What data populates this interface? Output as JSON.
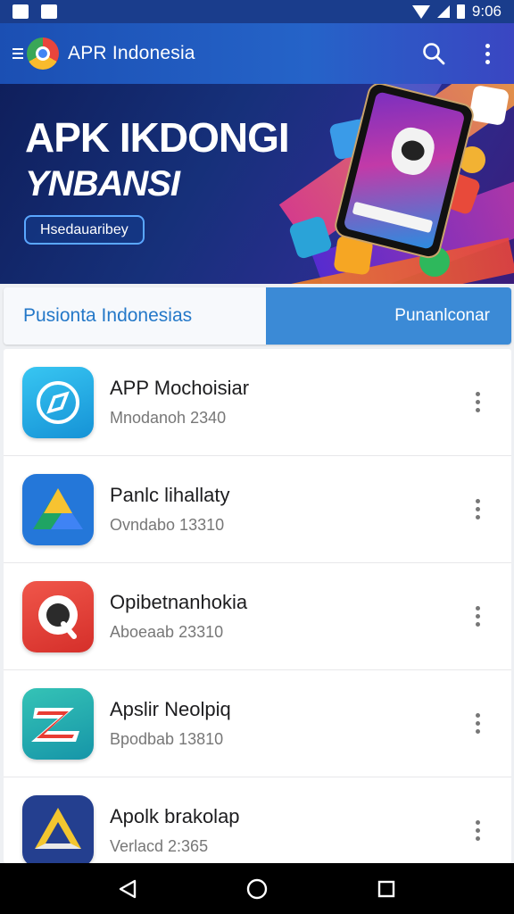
{
  "status_bar": {
    "time": "9:06"
  },
  "app_bar": {
    "title": "APR Indonesia"
  },
  "banner": {
    "title_line1": "APK IKDONGI",
    "title_line2": "YNBANSI",
    "button_label": "Hsedauaribey"
  },
  "tabs": [
    {
      "label": "Pusionta Indonesias",
      "selected": true
    },
    {
      "label": "Punanlconar",
      "selected": false
    }
  ],
  "apps": [
    {
      "name": "APP Mochoisiar",
      "meta": "Mnodanoh 2340",
      "icon": "compass-app-icon"
    },
    {
      "name": "Panlc lihallaty",
      "meta": "Ovndabo 13310",
      "icon": "drive-app-icon"
    },
    {
      "name": "Opibetnanhokia",
      "meta": "Aboeaab 23310",
      "icon": "quora-app-icon"
    },
    {
      "name": "Apslir Neolpiq",
      "meta": "Bpodbab 13810",
      "icon": "z-app-icon"
    },
    {
      "name": "Apolk brakolap",
      "meta": "Verlacd 2:365",
      "icon": "triangle-app-icon"
    }
  ],
  "colors": {
    "app_bar": "#1b4fb3",
    "tab_active_text": "#2478c8",
    "tab_inactive_bg": "#3b8ad6"
  }
}
